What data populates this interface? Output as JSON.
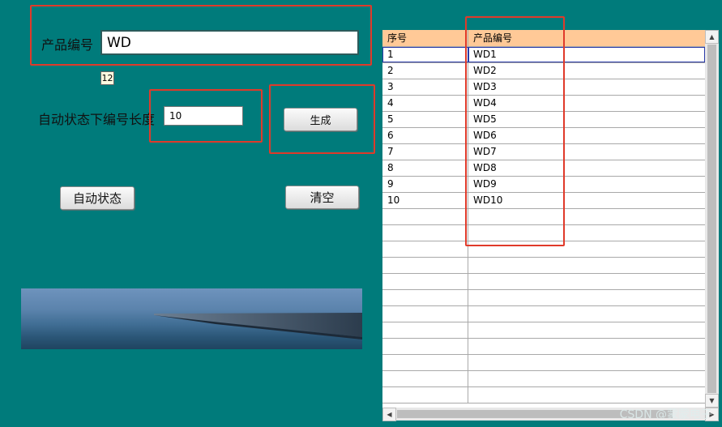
{
  "product_code": {
    "label": "产品编号",
    "value": "WD"
  },
  "length_counter": "12",
  "auto_length": {
    "label": "自动状态下编号长度",
    "value": "10"
  },
  "buttons": {
    "generate": "生成",
    "auto_state": "自动状态",
    "clear": "清空"
  },
  "photo_desc_icon": "pier-photo",
  "table": {
    "headers": [
      "序号",
      "产品编号"
    ],
    "rows": [
      [
        "1",
        "WD1"
      ],
      [
        "2",
        "WD2"
      ],
      [
        "3",
        "WD3"
      ],
      [
        "4",
        "WD4"
      ],
      [
        "5",
        "WD5"
      ],
      [
        "6",
        "WD6"
      ],
      [
        "7",
        "WD7"
      ],
      [
        "8",
        "WD8"
      ],
      [
        "9",
        "WD9"
      ],
      [
        "10",
        "WD10"
      ]
    ],
    "empty_rows": 12
  },
  "scrollbar": {
    "up": "▲",
    "down": "▼",
    "left": "◀",
    "right": "▶"
  },
  "watermark": "CSDN @蒙蒙电子",
  "colors": {
    "background": "#007B7B",
    "header": "#FFC997",
    "highlight": "#e03a2a"
  }
}
